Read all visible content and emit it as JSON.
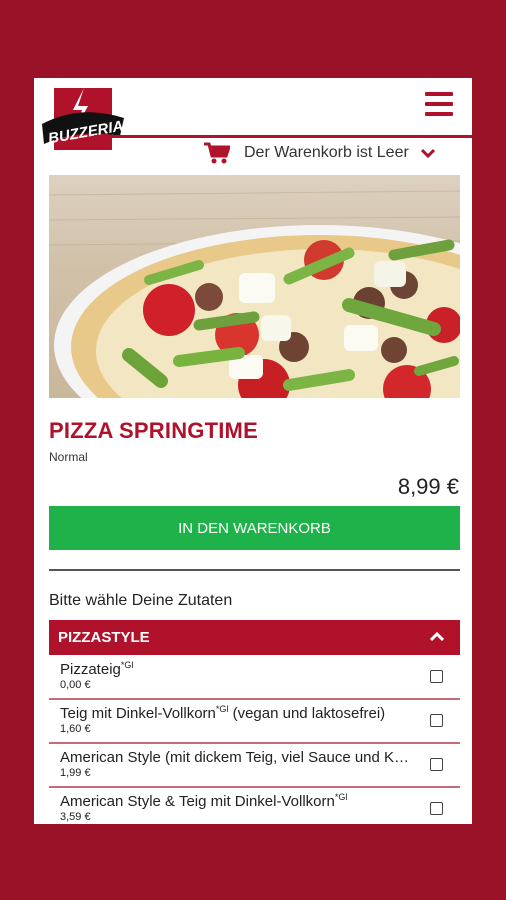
{
  "header": {
    "logo_text": "BUZZERIA",
    "cart_text": "Der Warenkorb ist Leer"
  },
  "product": {
    "name": "PIZZA SPRINGTIME",
    "size": "Normal",
    "price": "8,99 €",
    "add_button": "IN DEN WARENKORB"
  },
  "ingredients_prompt": "Bitte wähle Deine Zutaten",
  "section": {
    "title": "PIZZASTYLE",
    "options": [
      {
        "name": "Pizzateig",
        "note": "*Gl",
        "suffix": "",
        "price": "0,00 €"
      },
      {
        "name": "Teig mit Dinkel-Vollkorn",
        "note": "*Gl",
        "suffix": " (vegan und laktosefrei)",
        "price": "1,60 €"
      },
      {
        "name": "American Style (mit dickem Teig, viel Sauce und Käse)",
        "note": "",
        "suffix": "",
        "price": "1,99 €"
      },
      {
        "name": "American Style & Teig mit Dinkel-Vollkorn",
        "note": "*Gl",
        "suffix": "",
        "price": "3,59 €"
      }
    ]
  },
  "colors": {
    "background": "#9a1227",
    "brand_red": "#b0112b",
    "button_green": "#1fb24a"
  },
  "icons": [
    "menu-icon",
    "cart-icon",
    "chevron-down-icon",
    "chevron-up-icon"
  ]
}
